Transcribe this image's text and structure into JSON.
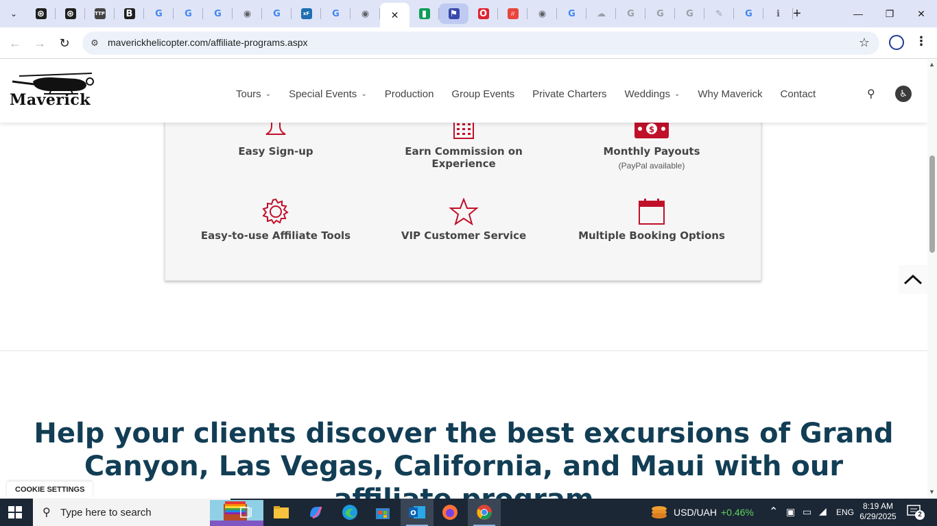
{
  "browser": {
    "tabs": [
      {
        "icon": "openai-icon",
        "color": "#1f1f1f",
        "glyph": "⊛"
      },
      {
        "icon": "openai-icon",
        "color": "#1f1f1f",
        "glyph": "⊛"
      },
      {
        "icon": "ttp-icon",
        "color": "#444444",
        "glyph": "TTP"
      },
      {
        "icon": "b-icon",
        "color": "#1f1f1f",
        "glyph": "B"
      },
      {
        "icon": "google-icon",
        "color": "#4285f4",
        "glyph": "G"
      },
      {
        "icon": "google-icon",
        "color": "#4285f4",
        "glyph": "G"
      },
      {
        "icon": "google-icon",
        "color": "#4285f4",
        "glyph": "G"
      },
      {
        "icon": "globe-icon",
        "color": "#5f6368",
        "glyph": "◉"
      },
      {
        "icon": "google-icon",
        "color": "#4285f4",
        "glyph": "G"
      },
      {
        "icon": "xf-icon",
        "color": "#1f6fb2",
        "glyph": "xF"
      },
      {
        "icon": "google-icon",
        "color": "#4285f4",
        "glyph": "G"
      },
      {
        "icon": "globe-icon",
        "color": "#5f6368",
        "glyph": "◉"
      },
      {
        "icon": "close-icon",
        "color": "#1f1f1f",
        "glyph": "✕",
        "active": true
      },
      {
        "icon": "chart-icon",
        "color": "#0f9d58",
        "glyph": "▮"
      },
      {
        "icon": "flag-icon",
        "color": "#3949ab",
        "glyph": "⚑",
        "highlight": true
      },
      {
        "icon": "opera-icon",
        "color": "#e0232f",
        "glyph": "O"
      },
      {
        "icon": "slash-icon",
        "color": "#e8453c",
        "glyph": "//"
      },
      {
        "icon": "globe-icon",
        "color": "#5f6368",
        "glyph": "◉"
      },
      {
        "icon": "google-icon",
        "color": "#4285f4",
        "glyph": "G"
      },
      {
        "icon": "cloud-icon",
        "color": "#9aa0a6",
        "glyph": "☁"
      },
      {
        "icon": "google-icon",
        "color": "#9aa0a6",
        "glyph": "G"
      },
      {
        "icon": "google-icon",
        "color": "#9aa0a6",
        "glyph": "G"
      },
      {
        "icon": "google-icon",
        "color": "#9aa0a6",
        "glyph": "G"
      },
      {
        "icon": "pen-icon",
        "color": "#9aa0a6",
        "glyph": "✎"
      },
      {
        "icon": "google-icon",
        "color": "#4285f4",
        "glyph": "G"
      },
      {
        "icon": "info-icon",
        "color": "#5f6368",
        "glyph": "ℹ"
      }
    ],
    "url": "maverickhelicopter.com/affiliate-programs.aspx"
  },
  "site": {
    "logo_text": "Maverick",
    "nav": [
      {
        "label": "Tours",
        "dropdown": true
      },
      {
        "label": "Special Events",
        "dropdown": true
      },
      {
        "label": "Production",
        "dropdown": false
      },
      {
        "label": "Group Events",
        "dropdown": false
      },
      {
        "label": "Private Charters",
        "dropdown": false
      },
      {
        "label": "Weddings",
        "dropdown": true
      },
      {
        "label": "Why Maverick",
        "dropdown": false
      },
      {
        "label": "Contact",
        "dropdown": false
      }
    ],
    "accent_color": "#c0102a",
    "headline_color": "#123e55"
  },
  "features": {
    "f1": {
      "title": "Easy Sign-up",
      "icon": "signup-icon"
    },
    "f2": {
      "title": "Earn Commission on Experience",
      "icon": "calculator-icon"
    },
    "f3": {
      "title": "Monthly Payouts",
      "subtitle": "(PayPal available)",
      "icon": "money-icon"
    },
    "f4": {
      "title": "Easy-to-use Affiliate Tools",
      "icon": "gear-icon"
    },
    "f5": {
      "title": "VIP Customer Service",
      "icon": "star-icon"
    },
    "f6": {
      "title": "Multiple Booking Options",
      "icon": "calendar-icon"
    }
  },
  "headline": "Help your clients discover the best excursions of Grand Canyon, Las Vegas, California, and Maui with our affiliate program",
  "cookie_label": "COOKIE SETTINGS",
  "taskbar": {
    "search_placeholder": "Type here to search",
    "currency": "USD/UAH",
    "currency_change": "+0.46%",
    "language": "ENG",
    "time": "8:19 AM",
    "date": "6/29/2025",
    "notifications": "2"
  }
}
